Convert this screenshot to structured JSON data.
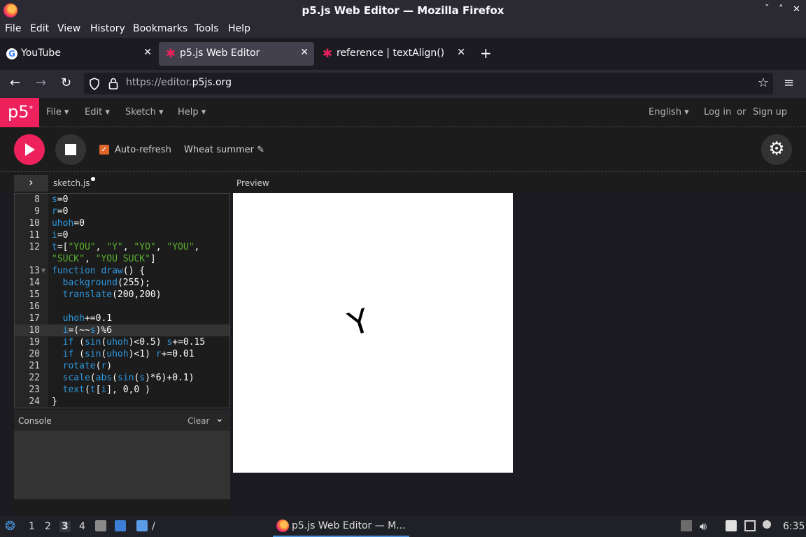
{
  "window": {
    "title": "p5.js Web Editor — Mozilla Firefox"
  },
  "menubar": {
    "items": [
      "File",
      "Edit",
      "View",
      "History",
      "Bookmarks",
      "Tools",
      "Help"
    ]
  },
  "tabs": [
    {
      "label": "YouTube",
      "icon": "google-icon"
    },
    {
      "label": "p5.js Web Editor",
      "icon": "p5-star-icon"
    },
    {
      "label": "reference | textAlign()",
      "icon": "p5-star-icon"
    }
  ],
  "address": {
    "prefix": "https://editor.",
    "domain": "p5js.org"
  },
  "p5": {
    "logo": "p5",
    "menus": [
      "File",
      "Edit",
      "Sketch",
      "Help"
    ],
    "language": "English",
    "login": "Log in",
    "or": "or",
    "signup": "Sign up",
    "accent": "#ed225d"
  },
  "toolbar": {
    "auto_refresh": "Auto-refresh",
    "auto_refresh_checked": true,
    "sketch_name": "Wheat summer"
  },
  "editor": {
    "filename": "sketch.js",
    "preview_label": "Preview",
    "current_line": 18,
    "line_numbers": [
      "8",
      "9",
      "10",
      "11",
      "12",
      "",
      "13",
      "14",
      "15",
      "16",
      "17",
      "18",
      "19",
      "20",
      "21",
      "22",
      "23",
      "24"
    ]
  },
  "console": {
    "label": "Console",
    "clear": "Clear"
  },
  "preview": {
    "text": "Y"
  },
  "taskbar": {
    "workspaces": [
      "1",
      "2",
      "3",
      "4"
    ],
    "active_workspace": "3",
    "window_label": "p5.js Web Editor — M...",
    "clock": "6:35"
  }
}
